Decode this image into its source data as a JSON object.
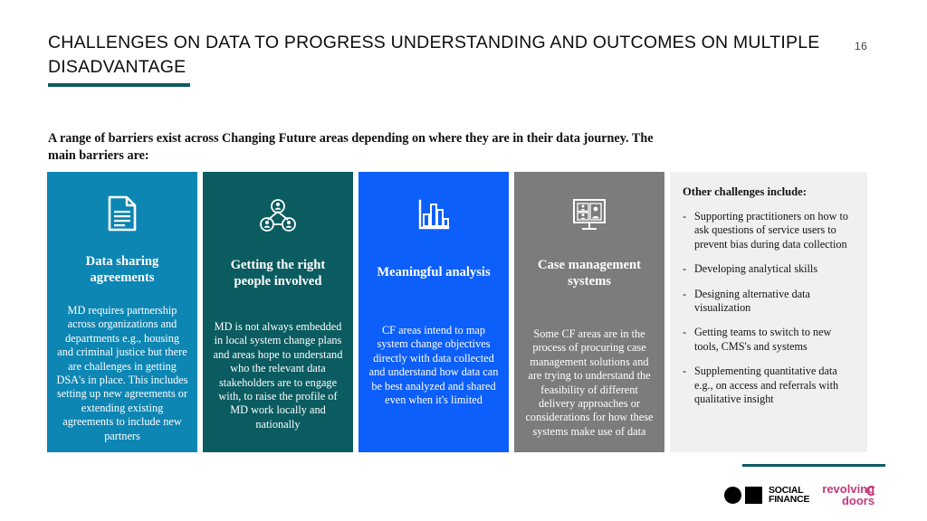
{
  "header": {
    "title": "CHALLENGES ON DATA TO PROGRESS UNDERSTANDING AND OUTCOMES ON MULTIPLE DISADVANTAGE",
    "page_number": "16",
    "accent_color": "#0d5c63"
  },
  "intro": {
    "text": "A range of barriers exist across Changing Future areas depending on where they are in their data journey. The main barriers are:"
  },
  "cards": [
    {
      "icon": "document-icon",
      "title": "Data sharing agreements",
      "body": "MD requires partnership across organizations and departments e.g., housing and criminal justice but there are challenges in getting DSA's in place. This includes setting up new agreements or extending existing agreements to include new partners",
      "color": "#0d86b4"
    },
    {
      "icon": "people-network-icon",
      "title": "Getting the right people involved",
      "body": "MD is not always embedded in local system change plans and areas hope to understand who the relevant data stakeholders are to engage with, to raise the profile of MD work locally and nationally",
      "color": "#0a5c60"
    },
    {
      "icon": "bar-chart-icon",
      "title": "Meaningful analysis",
      "body": "CF areas intend to map system change objectives directly with data collected and understand how data can be best analyzed and shared even when it's limited",
      "color": "#0d5ffb"
    },
    {
      "icon": "monitor-people-icon",
      "title": "Case management systems",
      "body": "Some CF areas are in the process of procuring case management solutions and are trying to understand the feasibility of different delivery approaches or considerations for how these systems make use of data",
      "color": "#7c7c7c"
    }
  ],
  "other_challenges": {
    "title": "Other challenges include:",
    "bullet_marker": "-",
    "items": [
      "Supporting practitioners on how to ask questions of service users to prevent bias during data collection",
      "Developing analytical skills",
      "Designing alternative data visualization",
      "Getting teams to switch to new tools, CMS's and systems",
      "Supplementing quantitative data e.g., on access and referrals with qualitative insight"
    ],
    "background_color": "#f0f0f0"
  },
  "footer": {
    "social_finance": {
      "line1": "SOCIAL",
      "line2": "FINANCE"
    },
    "revolving_doors": {
      "line1": "revolving",
      "line2": "doors",
      "color": "#c4387c"
    }
  }
}
